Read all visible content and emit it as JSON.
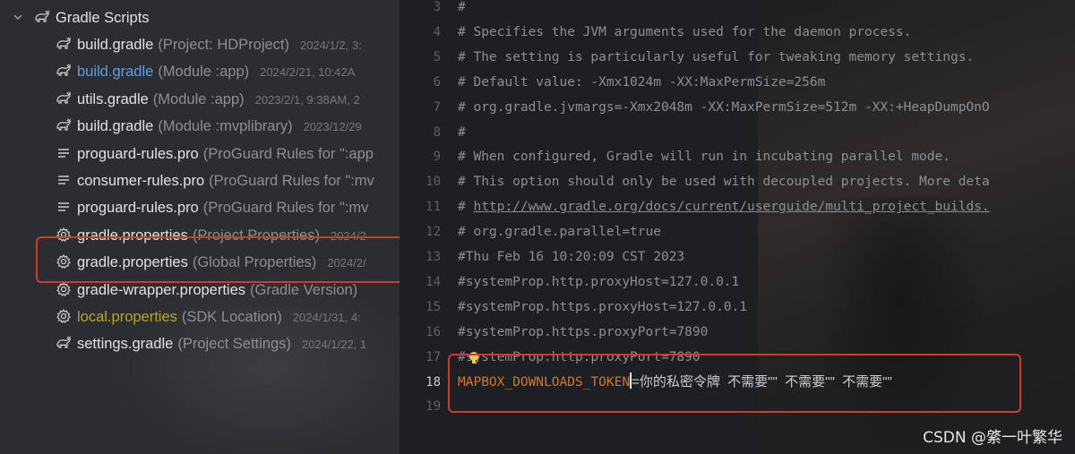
{
  "colors": {
    "tree_bg": "#2b2d30",
    "editor_bg": "#1e1f22",
    "modified_file": "#5f9fe0",
    "local_file": "#b5a438",
    "property_key": "#cc7832",
    "annotation_red": "#d23a2b"
  },
  "project_tree": {
    "group_label": "Gradle Scripts",
    "group_icon": "gradle-scripts-icon",
    "items": [
      {
        "name": "build.gradle",
        "desc": "(Project: HDProject)",
        "date": "2024/1/2, 3:",
        "icon": "gradle-elephant-icon",
        "state": "normal"
      },
      {
        "name": "build.gradle",
        "desc": "(Module :app)",
        "date": "2024/2/21, 10:42A",
        "icon": "gradle-elephant-icon",
        "state": "modified"
      },
      {
        "name": "utils.gradle",
        "desc": "(Module :app)",
        "date": "2023/2/1, 9:38AM, 2",
        "icon": "gradle-elephant-icon",
        "state": "normal"
      },
      {
        "name": "build.gradle",
        "desc": "(Module :mvplibrary)",
        "date": "2023/12/29",
        "icon": "gradle-elephant-icon",
        "state": "normal"
      },
      {
        "name": "proguard-rules.pro",
        "desc": "(ProGuard Rules for \":app",
        "date": "",
        "icon": "text-lines-icon",
        "state": "normal"
      },
      {
        "name": "consumer-rules.pro",
        "desc": "(ProGuard Rules for \":mv",
        "date": "",
        "icon": "text-lines-icon",
        "state": "normal"
      },
      {
        "name": "proguard-rules.pro",
        "desc": "(ProGuard Rules for \":mv",
        "date": "",
        "icon": "text-lines-icon",
        "state": "normal"
      },
      {
        "name": "gradle.properties",
        "desc": "(Project Properties)",
        "date": "2024/2",
        "icon": "gear-icon",
        "state": "normal"
      },
      {
        "name": "gradle.properties",
        "desc": "(Global Properties)",
        "date": "2024/2/",
        "icon": "gear-icon",
        "state": "normal"
      },
      {
        "name": "gradle-wrapper.properties",
        "desc": "(Gradle Version)",
        "date": "",
        "icon": "gear-icon",
        "state": "normal"
      },
      {
        "name": "local.properties",
        "desc": "(SDK Location)",
        "date": "2024/1/31, 4:",
        "icon": "gear-icon",
        "state": "local"
      },
      {
        "name": "settings.gradle",
        "desc": "(Project Settings)",
        "date": "2024/1/22, 1",
        "icon": "gradle-elephant-icon",
        "state": "normal"
      }
    ]
  },
  "editor": {
    "current_line": "18",
    "lines": [
      {
        "num": "3",
        "text": "#"
      },
      {
        "num": "4",
        "text": "# Specifies the JVM arguments used for the daemon process."
      },
      {
        "num": "5",
        "text": "# The setting is particularly useful for tweaking memory settings."
      },
      {
        "num": "6",
        "text": "# Default value: -Xmx1024m -XX:MaxPermSize=256m"
      },
      {
        "num": "7",
        "text": "# org.gradle.jvmargs=-Xmx2048m -XX:MaxPermSize=512m -XX:+HeapDumpOnO"
      },
      {
        "num": "8",
        "text": "#"
      },
      {
        "num": "9",
        "text": "# When configured, Gradle will run in incubating parallel mode."
      },
      {
        "num": "10",
        "text": "# This option should only be used with decoupled projects. More deta"
      },
      {
        "num": "11",
        "text_prefix": "# ",
        "url": "http://www.gradle.org/docs/current/userguide/multi_project_builds."
      },
      {
        "num": "12",
        "text": "# org.gradle.parallel=true"
      },
      {
        "num": "13",
        "text": "#Thu Feb 16 10:20:09 CST 2023"
      },
      {
        "num": "14",
        "text": "#systemProp.http.proxyHost=127.0.0.1"
      },
      {
        "num": "15",
        "text": "#systemProp.https.proxyHost=127.0.0.1"
      },
      {
        "num": "16",
        "text": "#systemProp.https.proxyPort=7890"
      },
      {
        "num": "17",
        "text": "#systemProp.http.proxyPort=7890"
      },
      {
        "num": "18",
        "key": "MAPBOX_DOWNLOADS_TOKEN",
        "value": "=你的私密令牌  不需要\"\"  不需要\"\"  不需要\"\""
      },
      {
        "num": "19",
        "text": ""
      }
    ]
  },
  "watermark": "CSDN @綮一叶繁华"
}
